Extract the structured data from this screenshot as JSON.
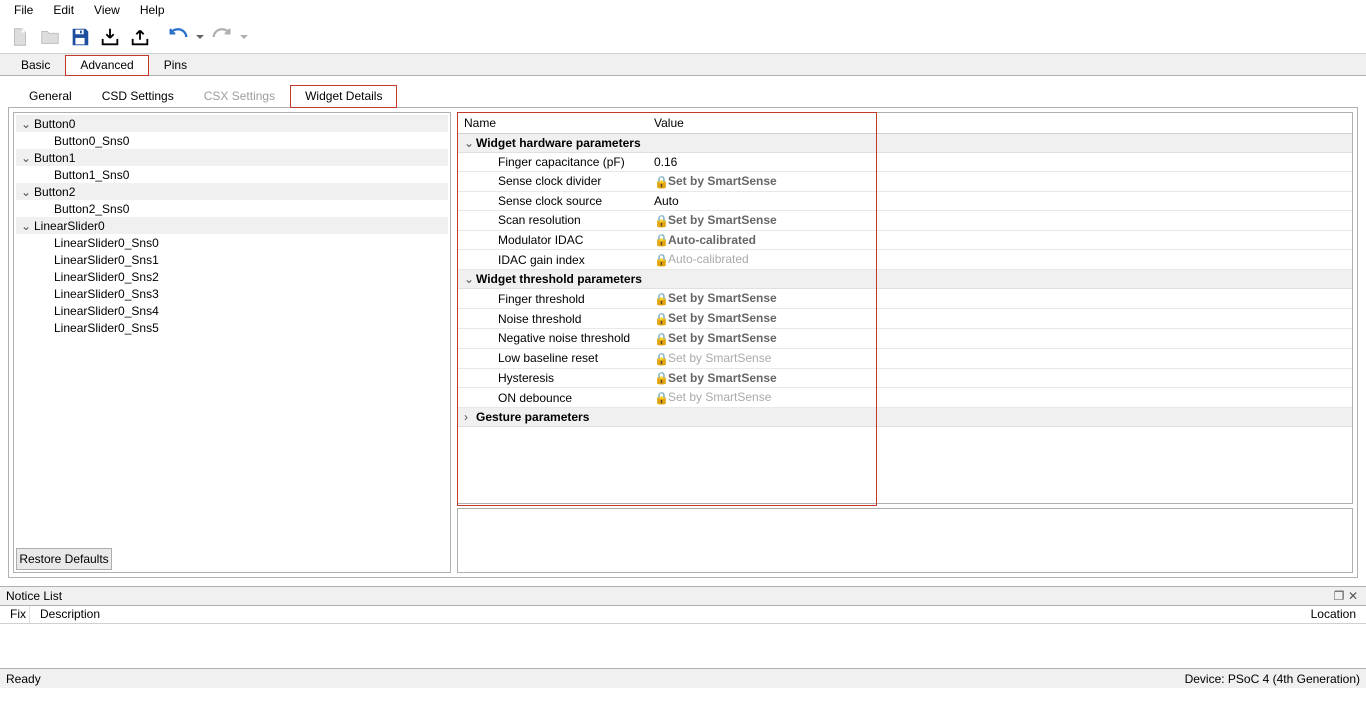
{
  "menu": {
    "file": "File",
    "edit": "Edit",
    "view": "View",
    "help": "Help"
  },
  "tabs": {
    "basic": "Basic",
    "advanced": "Advanced",
    "pins": "Pins"
  },
  "subtabs": {
    "general": "General",
    "csd": "CSD Settings",
    "csx": "CSX Settings",
    "widget": "Widget Details"
  },
  "tree": {
    "b0": "Button0",
    "b0s": "Button0_Sns0",
    "b1": "Button1",
    "b1s": "Button1_Sns0",
    "b2": "Button2",
    "b2s": "Button2_Sns0",
    "ls": "LinearSlider0",
    "ls0": "LinearSlider0_Sns0",
    "ls1": "LinearSlider0_Sns1",
    "ls2": "LinearSlider0_Sns2",
    "ls3": "LinearSlider0_Sns3",
    "ls4": "LinearSlider0_Sns4",
    "ls5": "LinearSlider0_Sns5"
  },
  "restore": "Restore Defaults",
  "grid": {
    "hname": "Name",
    "hval": "Value",
    "cat_hw": "Widget hardware parameters",
    "cat_th": "Widget threshold parameters",
    "cat_ge": "Gesture parameters",
    "p_finger_cap": "Finger capacitance (pF)",
    "v_finger_cap": "0.16",
    "p_sclk_div": "Sense clock divider",
    "p_sclk_src": "Sense clock source",
    "v_sclk_src": "Auto",
    "p_scan_res": "Scan resolution",
    "p_mod_idac": "Modulator IDAC",
    "v_mod_idac": "Auto-calibrated",
    "p_idac_gain": "IDAC gain index",
    "v_idac_gain": "Auto-calibrated",
    "p_fth": "Finger threshold",
    "p_nth": "Noise threshold",
    "p_nnth": "Negative noise threshold",
    "p_lbr": "Low baseline reset",
    "p_hys": "Hysteresis",
    "p_ondb": "ON debounce",
    "v_ss": "Set by SmartSense"
  },
  "notice": {
    "title": "Notice List",
    "fix": "Fix",
    "desc": "Description",
    "loc": "Location"
  },
  "status": {
    "ready": "Ready",
    "device": "Device: PSoC 4 (4th Generation)"
  }
}
